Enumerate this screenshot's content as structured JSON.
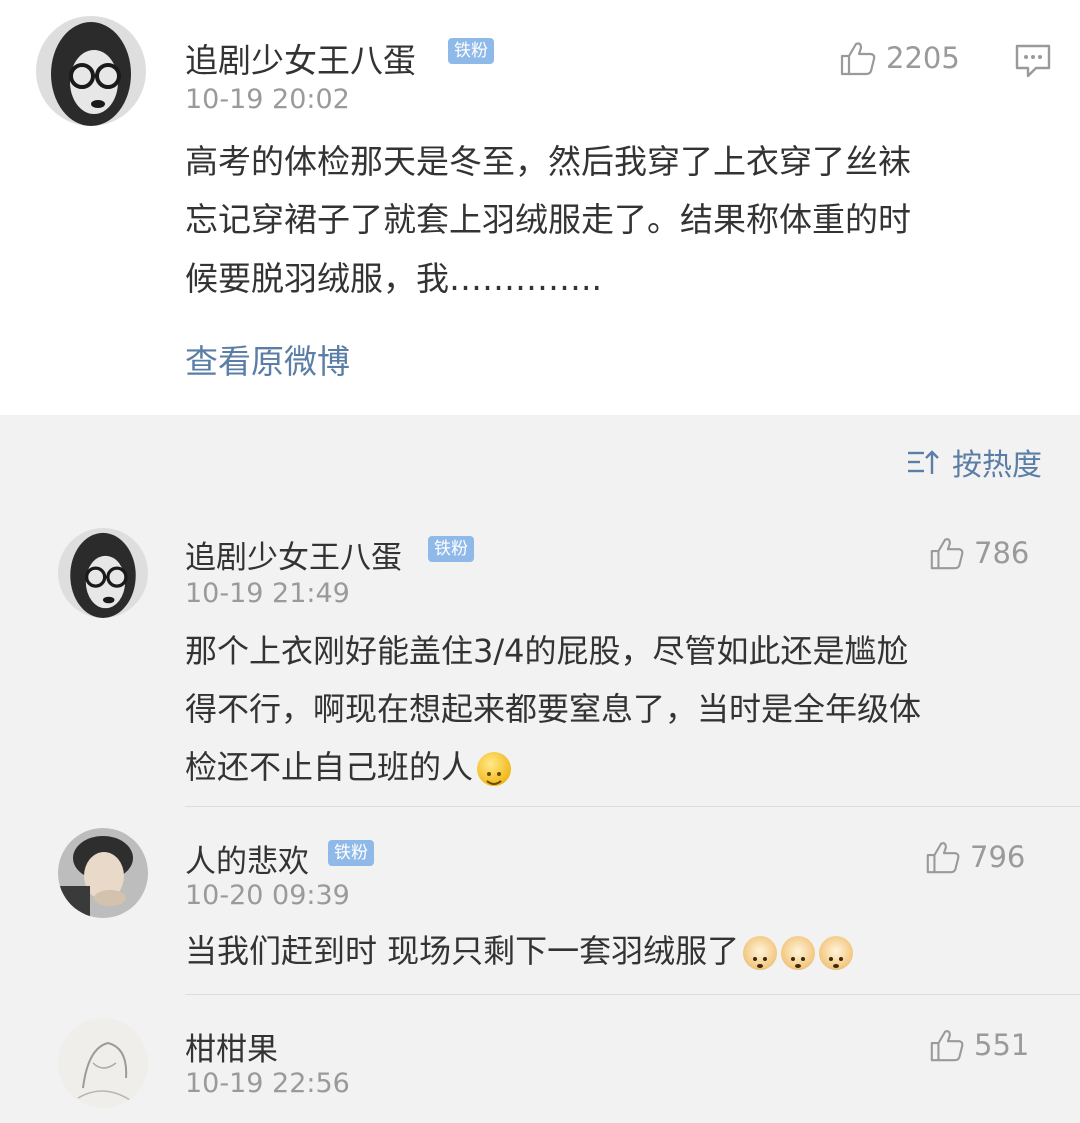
{
  "post": {
    "author": "追剧少女王八蛋",
    "badge": "铁粉",
    "time": "10-19 20:02",
    "likes": "2205",
    "content_lines": [
      "高考的体检那天是冬至，然后我穿了上衣穿了丝袜",
      "忘记穿裙子了就套上羽绒服走了。结果称体重的时",
      "候要脱羽绒服，我………….."
    ],
    "view_original": "查看原微博"
  },
  "sort": {
    "label": "按热度"
  },
  "comments": [
    {
      "author": "追剧少女王八蛋",
      "badge": "铁粉",
      "time": "10-19 21:49",
      "likes": "786",
      "lines": [
        "那个上衣刚好能盖住3/4的屁股，尽管如此还是尴尬",
        "得不行，啊现在想起来都要窒息了，当时是全年级体",
        "检还不止自己班的人"
      ],
      "emojis": [
        "smile-emoji"
      ]
    },
    {
      "author": "人的悲欢",
      "badge": "铁粉",
      "time": "10-20 09:39",
      "likes": "796",
      "lines": [
        "当我们赶到时 现场只剩下一套羽绒服了"
      ],
      "emojis": [
        "doge-emoji",
        "doge-emoji",
        "doge-emoji"
      ]
    },
    {
      "author": "柑柑果",
      "time": "10-19 22:56",
      "likes": "551"
    }
  ],
  "colors": {
    "link": "#5b7ea6",
    "badge": "#8fb9e8",
    "muted": "#9a9a9a",
    "background": "#f2f2f2"
  }
}
